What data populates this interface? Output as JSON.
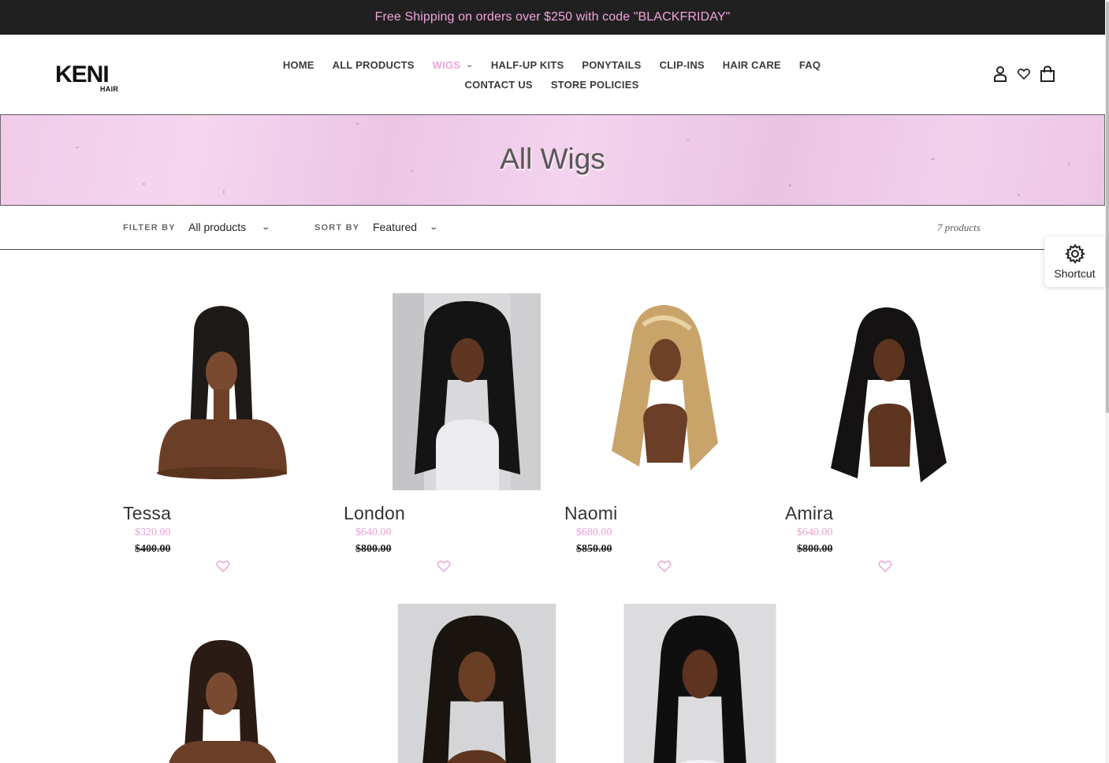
{
  "announcement": {
    "text": "Free Shipping on orders over $250 with code \"BLACKFRIDAY\""
  },
  "logo": {
    "main": "KENI",
    "sub": "HAIR"
  },
  "nav": {
    "row1": [
      {
        "label": "HOME"
      },
      {
        "label": "ALL PRODUCTS"
      },
      {
        "label": "WIGS"
      },
      {
        "label": "HALF-UP KITS"
      },
      {
        "label": "PONYTAILS"
      },
      {
        "label": "CLIP-INS"
      },
      {
        "label": "HAIR CARE"
      },
      {
        "label": "FAQ"
      }
    ],
    "row2": [
      {
        "label": "CONTACT US"
      },
      {
        "label": "STORE POLICIES"
      }
    ]
  },
  "hero": {
    "title": "All Wigs"
  },
  "filters": {
    "filter_label": "FILTER BY",
    "filter_value": "All products",
    "sort_label": "SORT BY",
    "sort_value": "Featured",
    "count": "7 products"
  },
  "shortcut": {
    "label": "Shortcut",
    "icon": "gear-icon"
  },
  "products": [
    {
      "name": "Tessa",
      "sale": "$320.00",
      "regular": "$400.00"
    },
    {
      "name": "London",
      "sale": "$640.00",
      "regular": "$800.00"
    },
    {
      "name": "Naomi",
      "sale": "$680.00",
      "regular": "$850.00"
    },
    {
      "name": "Amira",
      "sale": "$640.00",
      "regular": "$800.00"
    },
    {
      "name": "",
      "sale": "",
      "regular": ""
    },
    {
      "name": "",
      "sale": "",
      "regular": ""
    },
    {
      "name": "",
      "sale": "",
      "regular": ""
    }
  ],
  "colors": {
    "accent_pink": "#f0a4dc",
    "announcement_bg": "#202020",
    "hero_pink": "#f0cbe9"
  }
}
